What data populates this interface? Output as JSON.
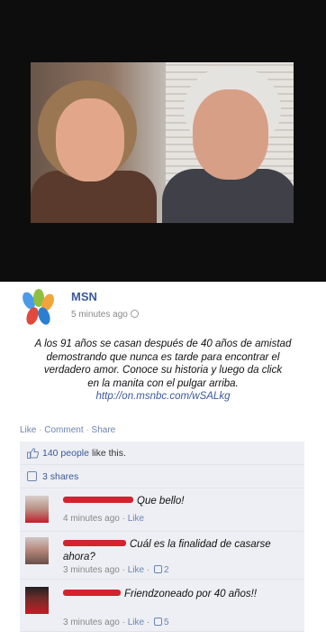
{
  "post": {
    "author": "MSN",
    "time": "5 minutes ago",
    "status_lines": [
      "A los 91 años se casan después de 40 años de amistad",
      "demostrando que nunca es tarde para encontrar el",
      "verdadero amor. Conoce su historia y luego da click",
      "en la manita con el pulgar arriba."
    ],
    "link": "http://on.msnbc.com/wSALkg"
  },
  "actions": {
    "like": "Like",
    "comment": "Comment",
    "share": "Share"
  },
  "likes": {
    "count": "140 people",
    "suffix": "like this."
  },
  "shares": "3 shares",
  "comments": [
    {
      "text": "Que bello!",
      "time": "4 minutes ago",
      "like": "Like",
      "likes": ""
    },
    {
      "text": "Cuál es la finalidad de casarse ahora?",
      "time": "3 minutes ago",
      "like": "Like",
      "likes": "2"
    },
    {
      "text": "Friendzoneado por 40 años!!",
      "time": "3 minutes ago",
      "like": "Like",
      "likes": "5"
    }
  ],
  "colors": {
    "fb_blue": "#3b5998",
    "link_blue": "#6d84b4",
    "redact_red": "#d4222e"
  }
}
